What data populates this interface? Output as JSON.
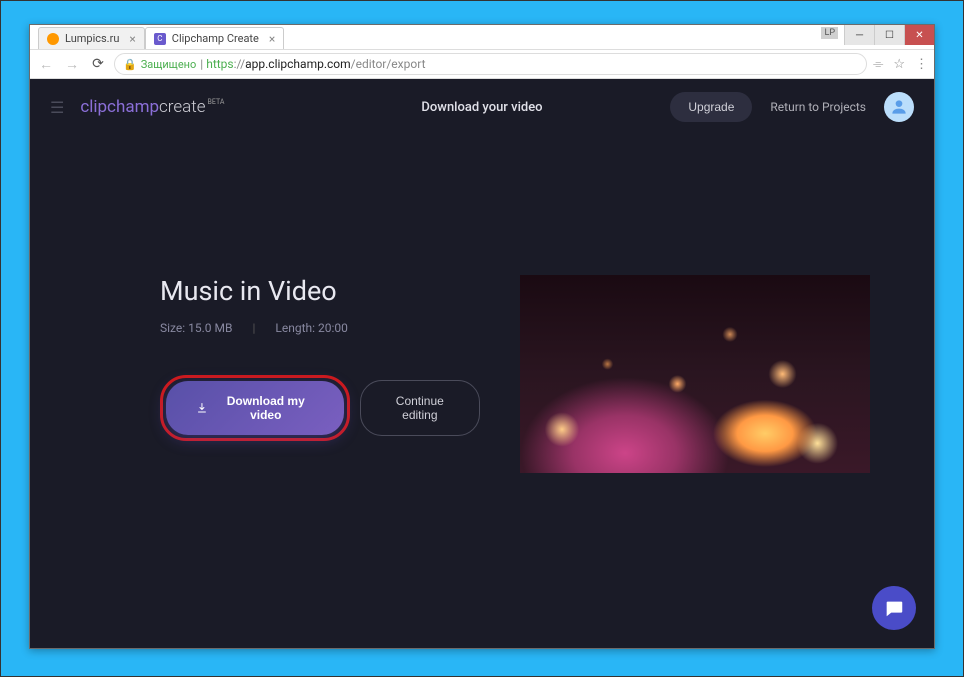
{
  "window": {
    "lp_badge": "LP",
    "tabs": [
      {
        "title": "Lumpics.ru",
        "favicon_color": "#ff9800"
      },
      {
        "title": "Clipchamp Create",
        "favicon_color": "#6a5acd"
      }
    ]
  },
  "addressbar": {
    "secure_label": "Защищено",
    "protocol": "https",
    "domain": "app.clipchamp.com",
    "path": "/editor/export"
  },
  "header": {
    "logo_part1": "clipchamp",
    "logo_part2": "create",
    "logo_beta": "BETA",
    "page_title": "Download your video",
    "upgrade_label": "Upgrade",
    "return_label": "Return to Projects"
  },
  "main": {
    "title": "Music in Video",
    "size_label": "Size: 15.0 MB",
    "length_label": "Length: 20:00",
    "download_label": "Download my video",
    "continue_label": "Continue editing"
  }
}
